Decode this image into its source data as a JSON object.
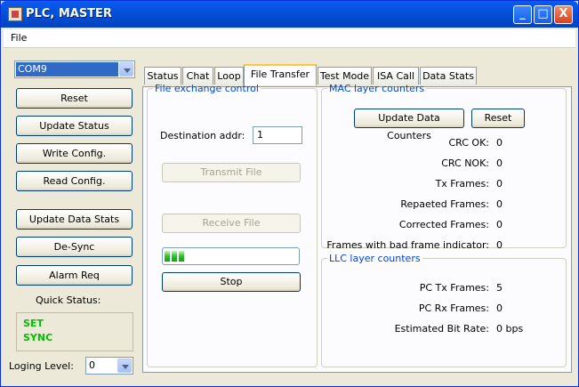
{
  "window": {
    "title": "PLC, MASTER",
    "minimize": "_",
    "maximize": "□",
    "close": "X"
  },
  "menu": {
    "file": "File"
  },
  "left": {
    "port": "COM9",
    "buttons": {
      "reset": "Reset",
      "update_status": "Update Status",
      "write_config": "Write Config.",
      "read_config": "Read Config.",
      "update_data_stats": "Update Data Stats",
      "desync": "De-Sync",
      "alarm_req": "Alarm Req"
    },
    "quick_status_label": "Quick Status:",
    "status_lines": [
      "SET",
      "SYNC"
    ],
    "loging_label": "Loging Level:",
    "loging_value": "0"
  },
  "tabs": [
    "Status",
    "Chat",
    "Loop",
    "File Transfer",
    "Test Mode",
    "ISA Call",
    "Data Stats"
  ],
  "active_tab": "File Transfer",
  "file_exchange": {
    "title": "File exchange control",
    "dest_label": "Destination addr:",
    "dest_value": "1",
    "transmit": "Transmit File",
    "receive": "Receive File",
    "progress_blocks": 3,
    "stop": "Stop"
  },
  "mac": {
    "title": "MAC layer counters",
    "update_button": "Update Data Counters",
    "reset_button": "Reset",
    "rows": [
      {
        "label": "CRC OK:",
        "value": "0"
      },
      {
        "label": "CRC NOK:",
        "value": "0"
      },
      {
        "label": "Tx Frames:",
        "value": "0"
      },
      {
        "label": "Repaeted Frames:",
        "value": "0"
      },
      {
        "label": "Corrected Frames:",
        "value": "0"
      },
      {
        "label": "Frames with bad frame indicator:",
        "value": "0"
      }
    ]
  },
  "llc": {
    "title": "LLC layer counters",
    "rows": [
      {
        "label": "PC Tx Frames:",
        "value": "5"
      },
      {
        "label": "PC Rx Frames:",
        "value": "0"
      },
      {
        "label": "Estimated Bit Rate:",
        "value": "0 bps"
      }
    ]
  },
  "colors": {
    "accent": "#0046d5",
    "status_green": "#00c000",
    "titlebar": "#0450d8"
  }
}
